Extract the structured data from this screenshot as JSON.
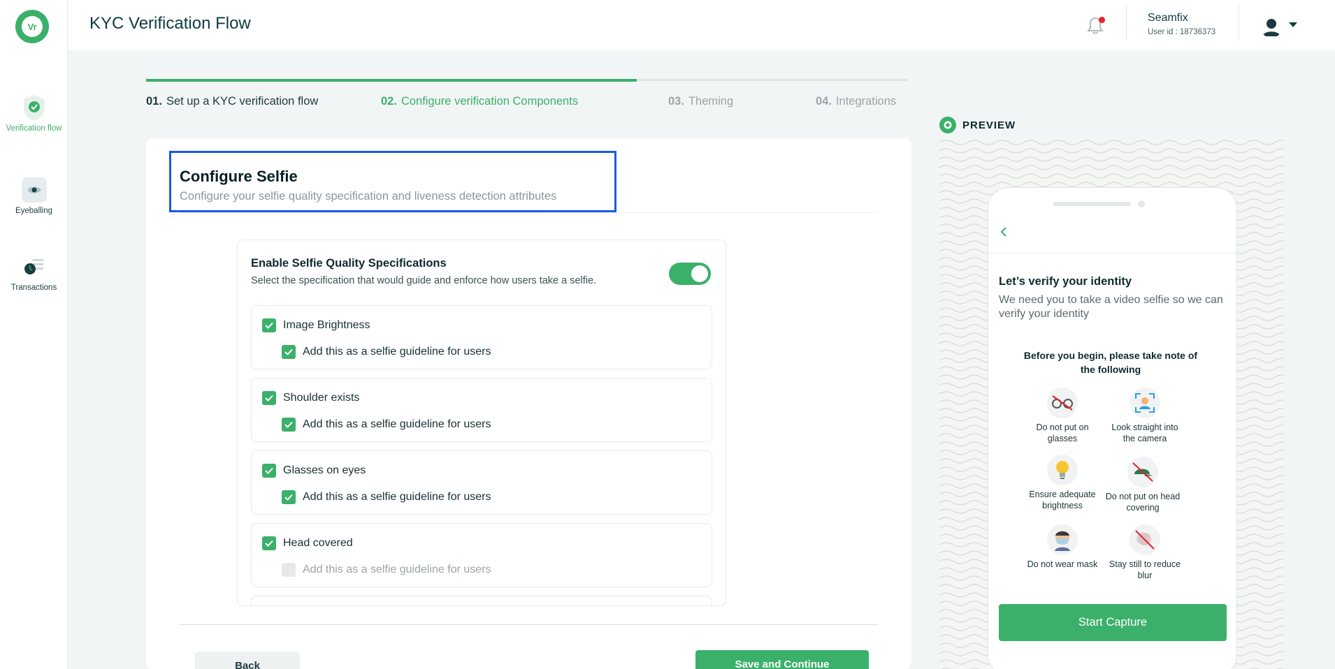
{
  "app": {
    "logo_text": "Vr"
  },
  "sidebar": {
    "items": [
      {
        "label": "Verification flow",
        "icon": "shield-check-icon",
        "active": true
      },
      {
        "label": "Eyeballing",
        "icon": "eye-icon",
        "active": false
      },
      {
        "label": "Transactions",
        "icon": "transactions-icon",
        "active": false
      }
    ]
  },
  "header": {
    "title": "KYC Verification Flow",
    "user_name": "Seamfix",
    "user_id": "User id : 18736373"
  },
  "stepper": {
    "progress": 0.645,
    "steps": [
      {
        "num": "01.",
        "label": "Set up a KYC verification flow",
        "state": "done"
      },
      {
        "num": "02.",
        "label": "Configure verification Components",
        "state": "current"
      },
      {
        "num": "03.",
        "label": "Theming",
        "state": "pending"
      },
      {
        "num": "04.",
        "label": "Integrations",
        "state": "pending"
      }
    ]
  },
  "main": {
    "title": "Configure Selfie",
    "subtitle": "Configure your selfie quality specification and liveness detection attributes",
    "spec_title": "Enable Selfie Quality Specifications",
    "spec_desc": "Select the specification that would guide and enforce how users take a selfie.",
    "toggle_on": true,
    "items": [
      {
        "label": "Image Brightness",
        "checked": true,
        "guideline": "Add this as a selfie guideline for users",
        "guideline_checked": true
      },
      {
        "label": "Shoulder exists",
        "checked": true,
        "guideline": "Add this as a selfie guideline for users",
        "guideline_checked": true
      },
      {
        "label": "Glasses on eyes",
        "checked": true,
        "guideline": "Add this as a selfie guideline for users",
        "guideline_checked": true
      },
      {
        "label": "Head covered",
        "checked": true,
        "guideline": "Add this as a selfie guideline for users",
        "guideline_checked": false
      }
    ],
    "back_label": "Back",
    "save_label": "Save and Continue"
  },
  "preview": {
    "label": "PREVIEW",
    "title": "Let’s verify your identity",
    "subtitle": "We need you to take a video selfie so we can verify your identity",
    "note": "Before you begin, please take note of the following",
    "tips": [
      {
        "text": "Do not put on glasses",
        "icon": "no-glasses-icon"
      },
      {
        "text": "Look straight into the camera",
        "icon": "face-frame-icon"
      },
      {
        "text": "Ensure adequate brightness",
        "icon": "lightbulb-icon"
      },
      {
        "text": "Do not put on head covering",
        "icon": "no-cap-icon"
      },
      {
        "text": "Do not wear mask",
        "icon": "mask-icon"
      },
      {
        "text": "Stay still to reduce blur",
        "icon": "no-blur-icon"
      }
    ],
    "button": "Start Capture"
  },
  "colors": {
    "accent": "#3bb06a",
    "highlight": "#1a5ae0",
    "alert": "#e8212b"
  }
}
